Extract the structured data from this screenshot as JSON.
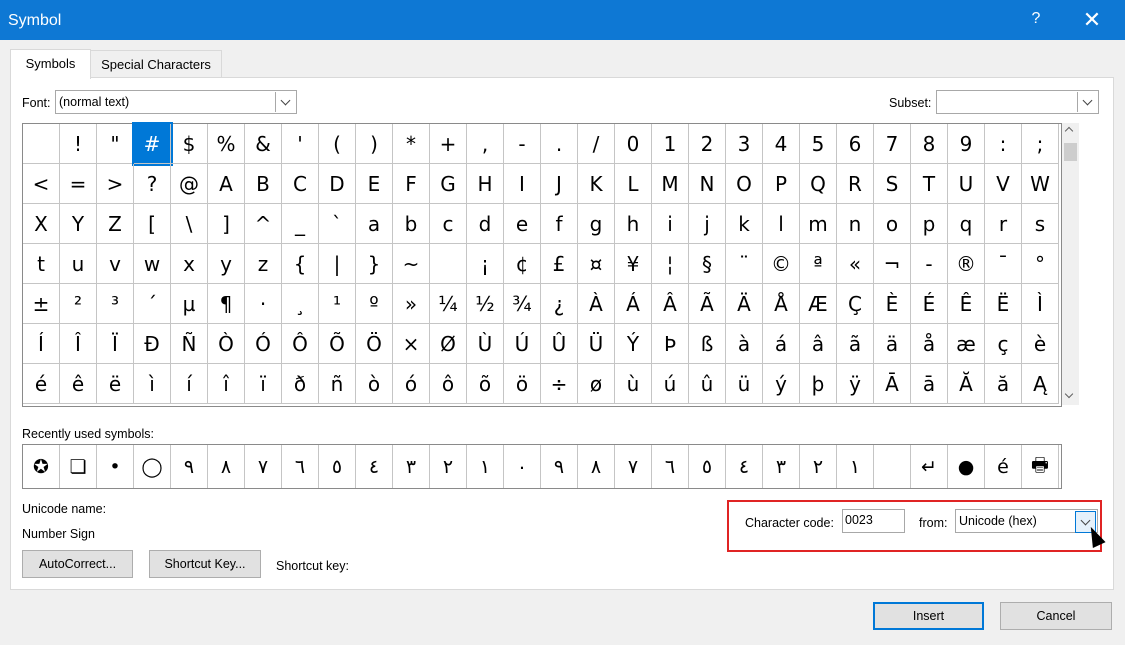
{
  "window": {
    "title": "Symbol",
    "help_label": "?",
    "close_label": "✕"
  },
  "tabs": [
    {
      "label": "Symbols",
      "active": true
    },
    {
      "label": "Special Characters",
      "active": false
    }
  ],
  "font": {
    "label": "Font:",
    "value": "(normal text)"
  },
  "subset": {
    "label": "Subset:",
    "value": ""
  },
  "symbols": [
    "",
    "!",
    "\"",
    "#",
    "$",
    "%",
    "&",
    "'",
    "(",
    ")",
    "*",
    "+",
    ",",
    "-",
    ".",
    "/",
    "0",
    "1",
    "2",
    "3",
    "4",
    "5",
    "6",
    "7",
    "8",
    "9",
    ":",
    ";",
    "<",
    "=",
    ">",
    "?",
    "@",
    "A",
    "B",
    "C",
    "D",
    "E",
    "F",
    "G",
    "H",
    "I",
    "J",
    "K",
    "L",
    "M",
    "N",
    "O",
    "P",
    "Q",
    "R",
    "S",
    "T",
    "U",
    "V",
    "W",
    "X",
    "Y",
    "Z",
    "[",
    "\\",
    "]",
    "^",
    "_",
    "`",
    "a",
    "b",
    "c",
    "d",
    "e",
    "f",
    "g",
    "h",
    "i",
    "j",
    "k",
    "l",
    "m",
    "n",
    "o",
    "p",
    "q",
    "r",
    "s",
    "t",
    "u",
    "v",
    "w",
    "x",
    "y",
    "z",
    "{",
    "|",
    "}",
    "~",
    "",
    "¡",
    "¢",
    "£",
    "¤",
    "¥",
    "¦",
    "§",
    "¨",
    "©",
    "ª",
    "«",
    "¬",
    "-",
    "®",
    "¯",
    "°",
    "±",
    "²",
    "³",
    "´",
    "µ",
    "¶",
    "·",
    "¸",
    "¹",
    "º",
    "»",
    "¼",
    "½",
    "¾",
    "¿",
    "À",
    "Á",
    "Â",
    "Ã",
    "Ä",
    "Å",
    "Æ",
    "Ç",
    "È",
    "É",
    "Ê",
    "Ë",
    "Ì",
    "Í",
    "Î",
    "Ï",
    "Đ",
    "Ñ",
    "Ò",
    "Ó",
    "Ô",
    "Õ",
    "Ö",
    "×",
    "Ø",
    "Ù",
    "Ú",
    "Û",
    "Ü",
    "Ý",
    "Þ",
    "ß",
    "à",
    "á",
    "â",
    "ã",
    "ä",
    "å",
    "æ",
    "ç",
    "è",
    "é",
    "ê",
    "ë",
    "ì",
    "í",
    "î",
    "ï",
    "ð",
    "ñ",
    "ò",
    "ó",
    "ô",
    "õ",
    "ö",
    "÷",
    "ø",
    "ù",
    "ú",
    "û",
    "ü",
    "ý",
    "þ",
    "ÿ",
    "Ā",
    "ā",
    "Ă",
    "ă",
    "Ą"
  ],
  "selected_index": 3,
  "recent": {
    "label": "Recently used symbols:",
    "items": [
      "✪",
      "❏",
      "•",
      "◯",
      "٩",
      "٨",
      "٧",
      "٦",
      "٥",
      "٤",
      "٣",
      "٢",
      "١",
      "٠",
      "٩",
      "٨",
      "٧",
      "٦",
      "٥",
      "٤",
      "٣",
      "٢",
      "١",
      "",
      "↵",
      "●",
      "é",
      "🖶"
    ]
  },
  "unicode_name": {
    "label": "Unicode name:",
    "value": "Number Sign"
  },
  "character_code": {
    "label": "Character code:",
    "value": "0023"
  },
  "from": {
    "label": "from:",
    "value": "Unicode (hex)"
  },
  "buttons": {
    "autocorrect": "AutoCorrect...",
    "shortcut_key": "Shortcut Key...",
    "shortcut_key_label": "Shortcut key:",
    "insert": "Insert",
    "cancel": "Cancel"
  }
}
